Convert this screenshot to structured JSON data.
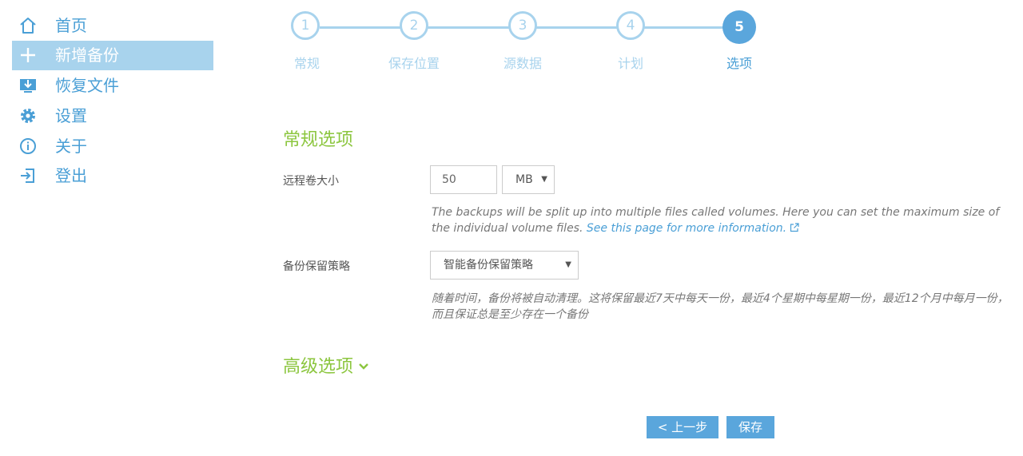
{
  "sidebar": {
    "items": [
      {
        "label": "首页",
        "icon": "home-icon"
      },
      {
        "label": "新增备份",
        "icon": "plus-icon"
      },
      {
        "label": "恢复文件",
        "icon": "restore-icon"
      },
      {
        "label": "设置",
        "icon": "gear-icon"
      },
      {
        "label": "关于",
        "icon": "info-icon"
      },
      {
        "label": "登出",
        "icon": "logout-icon"
      }
    ]
  },
  "wizard": {
    "current_step": 5,
    "steps": [
      {
        "number": "1",
        "label": "常规"
      },
      {
        "number": "2",
        "label": "保存位置"
      },
      {
        "number": "3",
        "label": "源数据"
      },
      {
        "number": "4",
        "label": "计划"
      },
      {
        "number": "5",
        "label": "选项"
      }
    ]
  },
  "general": {
    "title": "常规选项",
    "volume_size": {
      "label": "远程卷大小",
      "value": "50",
      "unit": "MB",
      "help_text": "The backups will be split up into multiple files called volumes. Here you can set the maximum size of the individual volume files.",
      "help_link": "See this page for more information."
    },
    "retention": {
      "label": "备份保留策略",
      "value": "智能备份保留策略",
      "help_text": "随着时间，备份将被自动清理。这将保留最近7天中每天一份，最近4个星期中每星期一份，最近12个月中每月一份，而且保证总是至少存在一个备份"
    }
  },
  "advanced": {
    "title": "高级选项"
  },
  "buttons": {
    "prev": "< 上一步",
    "save": "保存"
  },
  "colors": {
    "accent_blue": "#5aa6dc",
    "light_blue": "#a8d3ed",
    "section_green": "#8cc63f"
  }
}
